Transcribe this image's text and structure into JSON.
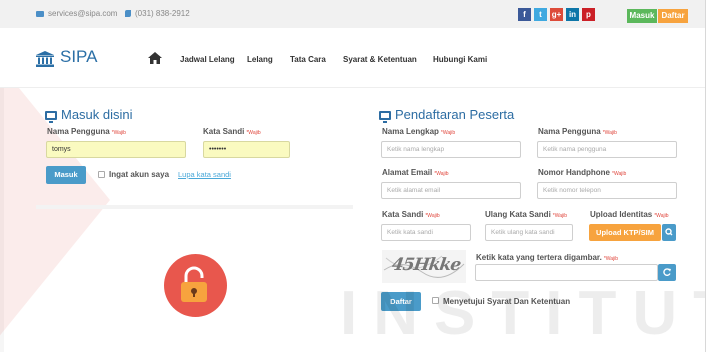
{
  "topbar": {
    "email": "services@sipa.com",
    "phone": "(031) 838-2912",
    "social": [
      {
        "name": "facebook-icon",
        "glyph": "f",
        "color": "#3b5998"
      },
      {
        "name": "twitter-icon",
        "glyph": "t",
        "color": "#3fa9e0"
      },
      {
        "name": "google-plus-icon",
        "glyph": "g+",
        "color": "#dd4b39"
      },
      {
        "name": "linkedin-icon",
        "glyph": "in",
        "color": "#0e76a8"
      },
      {
        "name": "pinterest-icon",
        "glyph": "p",
        "color": "#cb2027"
      }
    ],
    "masuk_label": "Masuk",
    "daftar_label": "Daftar"
  },
  "nav": {
    "logo": "SIPA",
    "items": [
      "Jadwal Lelang",
      "Lelang",
      "Tata Cara",
      "Syarat & Ketentuan",
      "Hubungi Kami"
    ]
  },
  "login": {
    "title": "Masuk disini",
    "username_label": "Nama Pengguna",
    "password_label": "Kata Sandi",
    "required_tag": "*Wajib",
    "username_value": "tomys",
    "password_value": "•••••••",
    "submit_label": "Masuk",
    "remember_label": "Ingat akun saya",
    "forgot_label": "Lupa kata sandi"
  },
  "register": {
    "title": "Pendaftaran Peserta",
    "required_tag": "*Wajib",
    "full_name_label": "Nama Lengkap",
    "full_name_placeholder": "Ketik nama lengkap",
    "username_label": "Nama Pengguna",
    "username_placeholder": "Ketik nama pengguna",
    "email_label": "Alamat Email",
    "email_placeholder": "Ketik alamat email",
    "phone_label": "Nomor Handphone",
    "phone_placeholder": "Ketik nomor telepon",
    "password_label": "Kata Sandi",
    "password_placeholder": "Ketik kata sandi",
    "repeat_label": "Ulang Kata Sandi",
    "repeat_placeholder": "Ketik ulang kata sandi",
    "upload_label": "Upload Identitas",
    "upload_button": "Upload KTP/SIM",
    "captcha_text": "45Hkke",
    "captcha_label": "Ketik kata yang tertera digambar.",
    "submit_label": "Daftar",
    "agree_label": "Menyetujui Syarat Dan Ketentuan"
  },
  "watermark": "INSTITUT BI",
  "colors": {
    "brand": "#2b6fa6",
    "primary_button": "#4a9bc9",
    "orange": "#f7a33e",
    "green": "#5cb85c",
    "required": "#e0463c"
  }
}
